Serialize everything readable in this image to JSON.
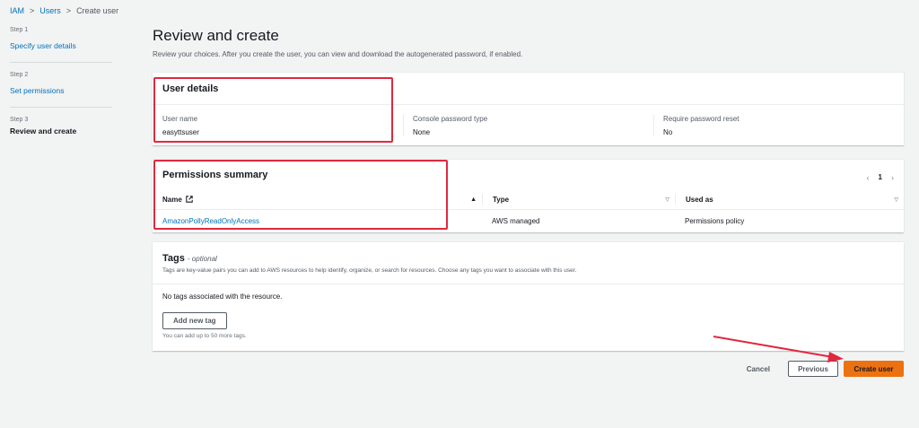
{
  "breadcrumb": {
    "items": [
      "IAM",
      "Users"
    ],
    "current": "Create user",
    "separator": ">"
  },
  "steps": [
    {
      "number": "Step 1",
      "title": "Specify user details"
    },
    {
      "number": "Step 2",
      "title": "Set permissions"
    },
    {
      "number": "Step 3",
      "title": "Review and create"
    }
  ],
  "page": {
    "title": "Review and create",
    "description": "Review your choices. After you create the user, you can view and download the autogenerated password, if enabled."
  },
  "user_details": {
    "title": "User details",
    "fields": [
      {
        "label": "User name",
        "value": "easyttsuser"
      },
      {
        "label": "Console password type",
        "value": "None"
      },
      {
        "label": "Require password reset",
        "value": "No"
      }
    ]
  },
  "permissions": {
    "title": "Permissions summary",
    "page_number": "1",
    "columns": [
      "Name",
      "Type",
      "Used as"
    ],
    "rows": [
      {
        "name": "AmazonPollyReadOnlyAccess",
        "type": "AWS managed",
        "used_as": "Permissions policy"
      }
    ]
  },
  "tags": {
    "title": "Tags",
    "optional": "- optional",
    "description": "Tags are key-value pairs you can add to AWS resources to help identify, organize, or search for resources. Choose any tags you want to associate with this user.",
    "empty_text": "No tags associated with the resource.",
    "add_label": "Add new tag",
    "limit_text": "You can add up to 50 more tags."
  },
  "actions": {
    "cancel": "Cancel",
    "previous": "Previous",
    "create": "Create user"
  },
  "colors": {
    "accent": "#ec7211",
    "link": "#0073bb",
    "annotation": "#e0283e"
  }
}
